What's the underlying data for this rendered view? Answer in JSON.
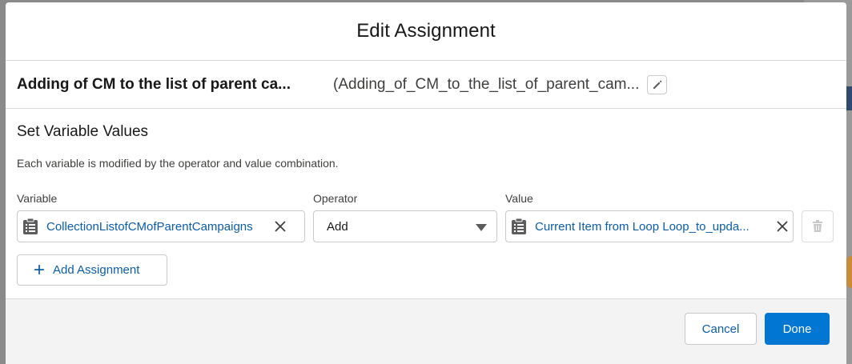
{
  "modal": {
    "title": "Edit Assignment"
  },
  "element": {
    "label": "Adding of CM to the list of parent ca...",
    "api_name": "(Adding_of_CM_to_the_list_of_parent_cam..."
  },
  "section": {
    "title": "Set Variable Values",
    "description": "Each variable is modified by the operator and value combination."
  },
  "columns": {
    "variable": "Variable",
    "operator": "Operator",
    "value": "Value"
  },
  "assignment": {
    "variable": "CollectionListofCMofParentCampaigns",
    "operator": "Add",
    "value": "Current Item from Loop Loop_to_upda..."
  },
  "buttons": {
    "add_assignment": "Add Assignment",
    "cancel": "Cancel",
    "done": "Done"
  },
  "colors": {
    "brand": "#0176d3",
    "link": "#0b5cab"
  },
  "icons": {
    "variable_resource": "clipboard-icon",
    "value_resource": "clipboard-icon",
    "edit": "pencil-icon",
    "remove": "close-icon",
    "delete": "trash-icon",
    "add": "plus-icon",
    "operator_caret": "chevron-down-icon"
  }
}
